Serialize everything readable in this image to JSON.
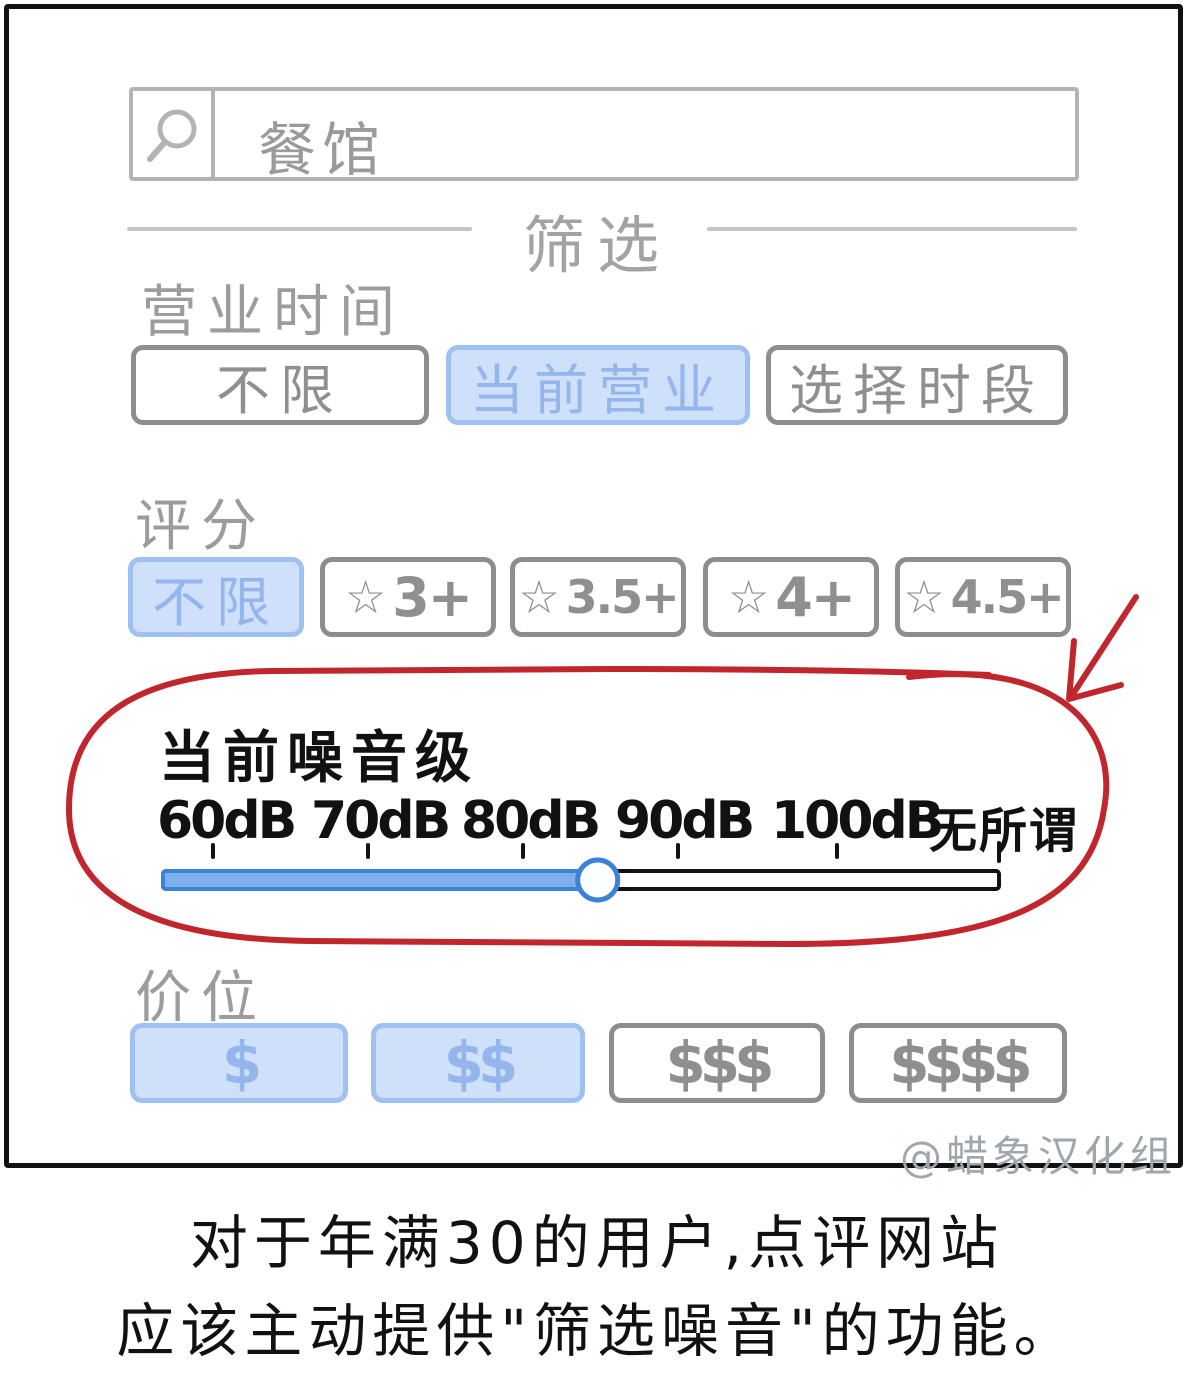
{
  "search": {
    "placeholder_value": "餐馆"
  },
  "filter": {
    "title": "筛选"
  },
  "hours": {
    "label": "营业时间",
    "options": [
      {
        "label": "不限",
        "selected": false
      },
      {
        "label": "当前营业",
        "selected": true
      },
      {
        "label": "选择时段",
        "selected": false
      }
    ]
  },
  "rating": {
    "label": "评分",
    "any_label": "不限",
    "options": [
      {
        "star": "☆",
        "value": "3+"
      },
      {
        "star": "☆",
        "value": "3.5+"
      },
      {
        "star": "☆",
        "value": "4+"
      },
      {
        "star": "☆",
        "value": "4.5+"
      }
    ]
  },
  "noise": {
    "label": "当前噪音级",
    "ticks": [
      "60dB",
      "70dB",
      "80dB",
      "90dB",
      "100dB",
      "无所谓"
    ],
    "slider_value_fraction": 0.52,
    "slider_selected_value": "~85dB"
  },
  "price": {
    "label": "价位",
    "options": [
      {
        "label": "$",
        "selected": true
      },
      {
        "label": "$$",
        "selected": true
      },
      {
        "label": "$$$",
        "selected": false
      },
      {
        "label": "$$$$",
        "selected": false
      }
    ]
  },
  "watermark": "@蜡象汉化组",
  "caption": {
    "line1": "对于年满30的用户,点评网站",
    "line2": "应该主动提供\"筛选噪音\"的功能。"
  },
  "colors": {
    "accent_fill": "#cfe0fb",
    "accent_border": "#9ec0f2",
    "slider_blue": "#3b82d6",
    "annotation_red": "#c0262c"
  }
}
